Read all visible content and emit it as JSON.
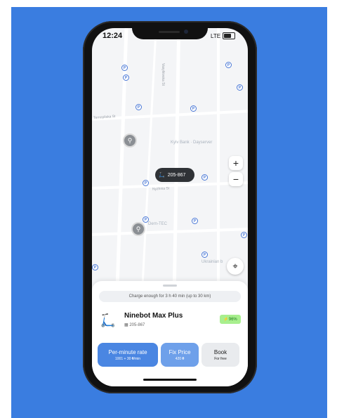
{
  "status_bar": {
    "time": "12:24",
    "network": "LTE"
  },
  "map": {
    "street_labels": [
      "Ternopilska St",
      "Vasylkivska St",
      "Nyzhnia St"
    ],
    "poi_labels": [
      "Kyiv Bank · Dayserver",
      "Dern-TEC",
      "Ukrainian b"
    ],
    "selected_vehicle": "205-867",
    "zoom_in": "+",
    "zoom_out": "−"
  },
  "sheet": {
    "charge_text": "Charge enough for 3 h 40 min (up to 30 km)",
    "vehicle_name": "Ninebot Max Plus",
    "vehicle_id": "205-867",
    "battery": "96%",
    "rates": [
      {
        "title": "Per-minute rate",
        "subtitle": "1001 + 30 ₴/min"
      },
      {
        "title": "Fix Price",
        "subtitle": "420 ₴"
      },
      {
        "title": "Book",
        "subtitle": "For free"
      }
    ]
  },
  "colors": {
    "background": "#3a7de0",
    "per_minute": "#4a86e2",
    "fix_price": "#6ea0ea",
    "battery_badge": "#a8ef8e"
  }
}
